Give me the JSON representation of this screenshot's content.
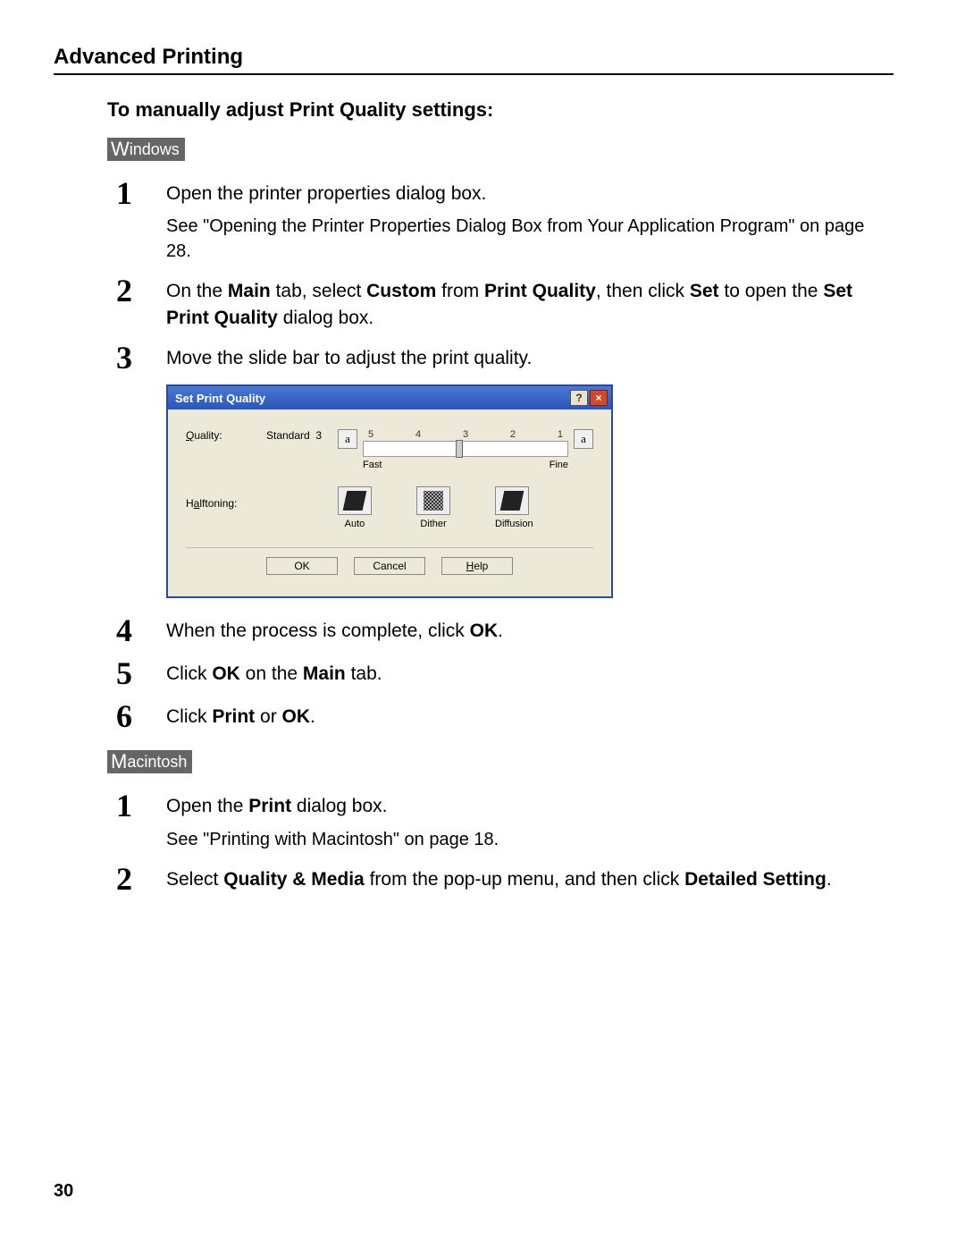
{
  "header": {
    "title": "Advanced Printing"
  },
  "subheading": "To manually adjust Print Quality settings:",
  "badges": {
    "windows": "Windows",
    "macintosh": "Macintosh"
  },
  "windows_steps": [
    {
      "num": "1",
      "head": "Open the printer properties dialog box.",
      "sub": "See \"Opening the Printer Properties Dialog Box from Your Application Program\" on page 28."
    },
    {
      "num": "2",
      "head": "On the <b>Main</b> tab, select <b>Custom</b> from <b>Print Quality</b>, then click <b>Set</b> to open the <b>Set Print Quality</b> dialog box."
    },
    {
      "num": "3",
      "head": "Move the slide bar to adjust the print quality."
    },
    {
      "num": "4",
      "head": "When the process is complete, click <b>OK</b>."
    },
    {
      "num": "5",
      "head": "Click <b>OK</b> on the <b>Main</b> tab."
    },
    {
      "num": "6",
      "head": "Click <b>Print</b> or <b>OK</b>."
    }
  ],
  "mac_steps": [
    {
      "num": "1",
      "head": "Open the <b>Print</b> dialog box.",
      "sub": "See \"Printing with Macintosh\" on page 18."
    },
    {
      "num": "2",
      "head": "Select <b>Quality & Media</b> from the pop-up menu, and then click <b>Detailed Setting</b>."
    }
  ],
  "dialog": {
    "title": "Set Print Quality",
    "quality_label": "Quality:",
    "quality_value": "Standard",
    "quality_num": "3",
    "ticks": [
      "5",
      "4",
      "3",
      "2",
      "1"
    ],
    "fast_label": "Fast",
    "fine_label": "Fine",
    "fast_glyph": "a",
    "fine_glyph": "a",
    "halftoning_label": "Halftoning:",
    "halftone_opts": [
      "Auto",
      "Dither",
      "Diffusion"
    ],
    "buttons": {
      "ok": "OK",
      "cancel": "Cancel",
      "help": "Help"
    }
  },
  "page_number": "30"
}
